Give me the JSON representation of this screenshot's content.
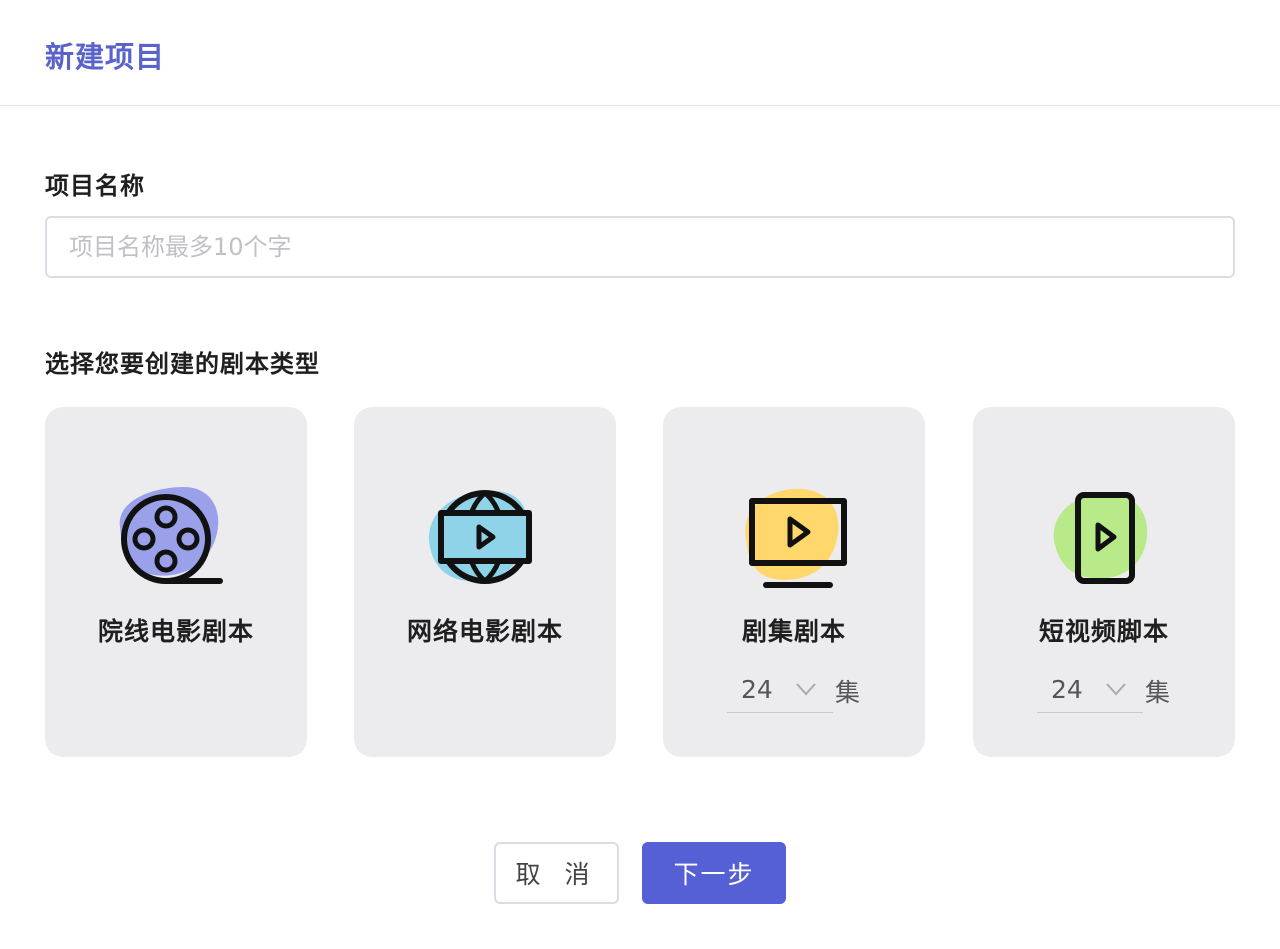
{
  "dialog": {
    "title": "新建项目"
  },
  "form": {
    "name_label": "项目名称",
    "name_placeholder": "项目名称最多10个字",
    "name_value": "",
    "type_label": "选择您要创建的剧本类型"
  },
  "types": [
    {
      "label": "院线电影剧本",
      "icon": "film-reel-icon",
      "blob_color": "#9aa1ea"
    },
    {
      "label": "网络电影剧本",
      "icon": "globe-play-icon",
      "blob_color": "#8fd3e8"
    },
    {
      "label": "剧集剧本",
      "icon": "tv-play-icon",
      "blob_color": "#ffd76a",
      "episodes": {
        "value": "24",
        "unit": "集"
      }
    },
    {
      "label": "短视频脚本",
      "icon": "phone-play-icon",
      "blob_color": "#b8ea8a",
      "episodes": {
        "value": "24",
        "unit": "集"
      }
    }
  ],
  "buttons": {
    "cancel": "取 消",
    "next": "下一步"
  }
}
